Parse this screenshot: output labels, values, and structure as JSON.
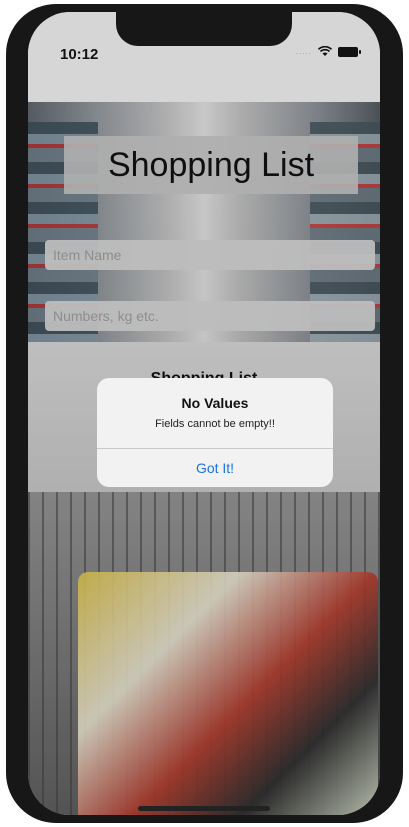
{
  "status_bar": {
    "time": "10:12",
    "signal": "....."
  },
  "app": {
    "title": "Shopping List",
    "item_name_placeholder": "Item Name",
    "quantity_placeholder": "Numbers, kg etc.",
    "list_heading": "Shopping List"
  },
  "alert": {
    "title": "No Values",
    "message": "Fields cannot be empty!!",
    "button_label": "Got It!"
  },
  "colors": {
    "accent": "#1a73e8",
    "alert_bg": "#f2f2f2",
    "device_frame": "#171717"
  }
}
